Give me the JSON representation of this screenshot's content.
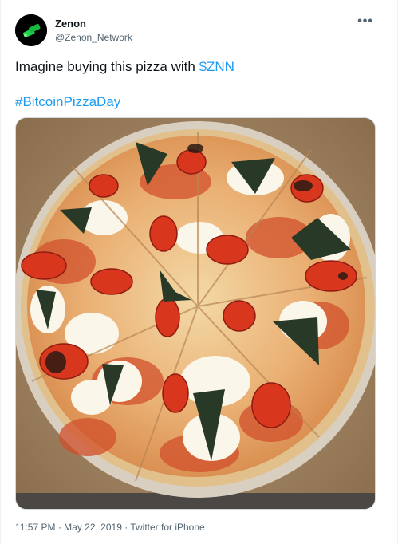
{
  "author": {
    "name": "Zenon",
    "handle": "@Zenon_Network"
  },
  "more_menu": "•••",
  "tweet": {
    "text_prefix": "Imagine buying this pizza with ",
    "cashtag": "$ZNN",
    "hashtag": "#BitcoinPizzaDay"
  },
  "meta": {
    "time": "11:57 PM",
    "separator": " · ",
    "date": "May 22, 2019",
    "source": "Twitter for iPhone"
  },
  "colors": {
    "link": "#1d9bf0",
    "text": "#0f1419",
    "secondary": "#536471",
    "avatar_bg": "#000000",
    "avatar_glyph": "#22c55e"
  },
  "media": {
    "icon": "pizza-photo"
  }
}
